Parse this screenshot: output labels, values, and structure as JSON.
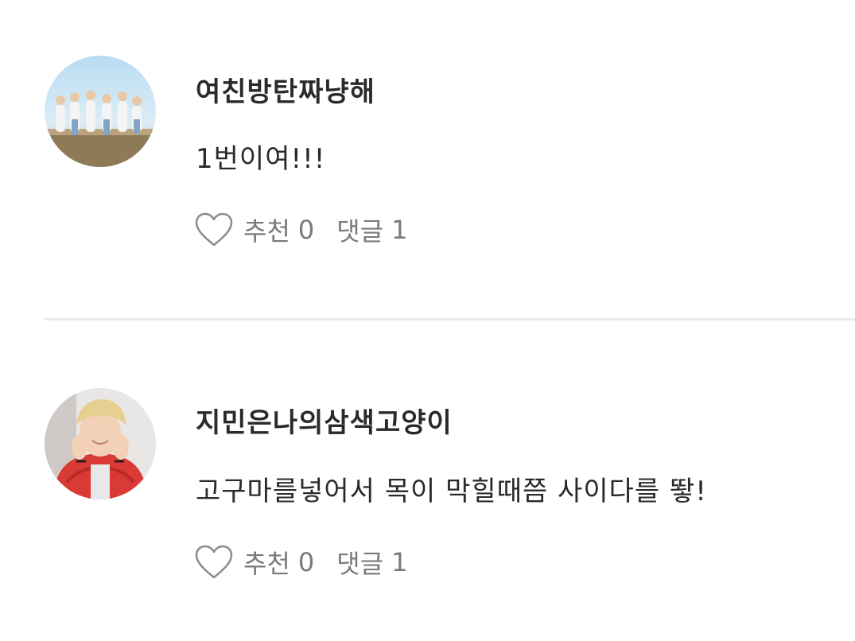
{
  "comments": [
    {
      "username": "여친방탄짜냥해",
      "text": "1번이여!!!",
      "like_label": "추천",
      "like_count": "0",
      "reply_label": "댓글",
      "reply_count": "1",
      "avatar": "group-photo-sky-background"
    },
    {
      "username": "지민은나의삼색고양이",
      "text": "고구마를넣어서 목이 막힐때쯤 사이다를 뙇!",
      "like_label": "추천",
      "like_count": "0",
      "reply_label": "댓글",
      "reply_count": "1",
      "avatar": "person-red-jacket"
    }
  ],
  "icons": {
    "like": "heart-outline-icon"
  },
  "colors": {
    "text": "#2a2a2a",
    "muted": "#7a7a7a",
    "divider": "#e6ecec"
  }
}
